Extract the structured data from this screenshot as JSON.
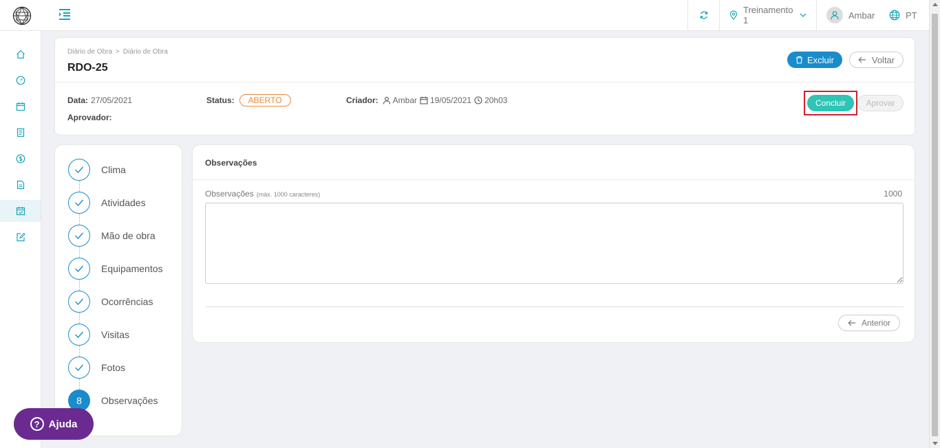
{
  "topbar": {
    "location": "Treinamento 1",
    "user": "Ambar",
    "language": "PT"
  },
  "header": {
    "breadcrumb": [
      "Diário de Obra",
      ">",
      "Diário de Obra"
    ],
    "title": "RDO-25",
    "delete_label": "Excluir",
    "back_label": "Voltar",
    "date_label": "Data:",
    "date_value": "27/05/2021",
    "status_label": "Status:",
    "status_value": "ABERTO",
    "creator_label": "Criador:",
    "creator_name": "Ambar",
    "created_date": "19/05/2021",
    "created_time": "20h03",
    "approver_label": "Aprovador:",
    "conclude_label": "Concluir",
    "approve_label": "Aprovar"
  },
  "steps": [
    {
      "label": "Clima",
      "state": "done"
    },
    {
      "label": "Atividades",
      "state": "done"
    },
    {
      "label": "Mão de obra",
      "state": "done"
    },
    {
      "label": "Equipamentos",
      "state": "done"
    },
    {
      "label": "Ocorrências",
      "state": "done"
    },
    {
      "label": "Visitas",
      "state": "done"
    },
    {
      "label": "Fotos",
      "state": "done"
    },
    {
      "label": "Observações",
      "state": "current",
      "number": "8"
    }
  ],
  "content": {
    "section_title": "Observações",
    "field_label": "Observações",
    "field_hint": "(máx. 1000 caracteres)",
    "field_counter": "1000",
    "field_value": "",
    "previous_label": "Anterior"
  },
  "help": {
    "label": "Ajuda",
    "icon_glyph": "?"
  },
  "colors": {
    "primary": "#1a8ccc",
    "teal": "#2ec4b6",
    "status_orange": "#e8883a",
    "help_purple": "#6a2a8f",
    "highlight_red": "#d0202b"
  }
}
